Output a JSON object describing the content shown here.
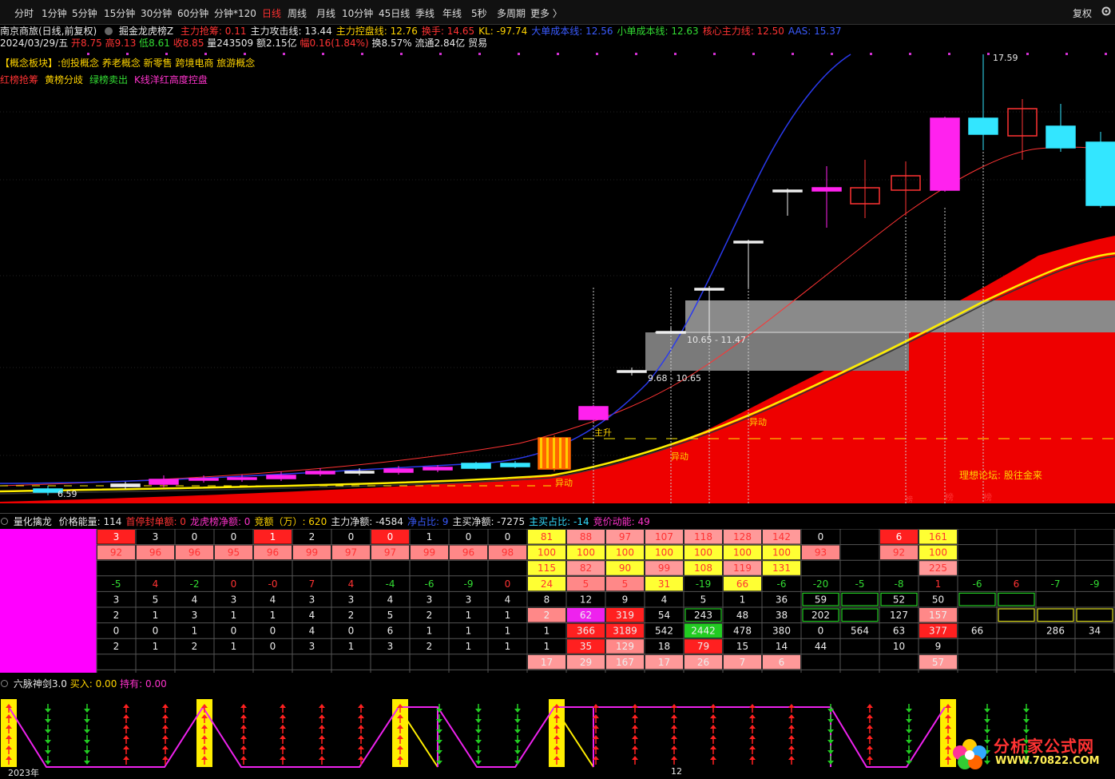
{
  "toolbar": {
    "items": [
      "分时",
      "1分钟",
      "5分钟",
      "15分钟",
      "30分钟",
      "60分钟",
      "分钟*120",
      "日线",
      "周线",
      "月线",
      "10分钟",
      "45日线",
      "季线",
      "年线",
      "5秒",
      "多周期",
      "更多 〉"
    ],
    "active_index": 7,
    "right": "复权"
  },
  "header": {
    "title": "南京商旅(日线,前复权)",
    "indicator": "掘金龙虎榜Z",
    "metrics": [
      {
        "k": "主力抢筹: ",
        "v": "0.11",
        "c": "red"
      },
      {
        "k": "主力攻击线: ",
        "v": "13.44",
        "c": "white"
      },
      {
        "k": "主力控盘线: ",
        "v": "12.76",
        "c": "yel"
      },
      {
        "k": "换手: ",
        "v": "14.65",
        "c": "red"
      },
      {
        "k": "KL: ",
        "v": "-97.74",
        "c": "yel"
      },
      {
        "k": "大单成本线: ",
        "v": "12.56",
        "c": "blue"
      },
      {
        "k": "小单成本线: ",
        "v": "12.63",
        "c": "grn"
      },
      {
        "k": "核心主力线: ",
        "v": "12.50",
        "c": "red"
      },
      {
        "k": "AAS: ",
        "v": "15.37",
        "c": "blue"
      }
    ],
    "date": "2024/03/29/五",
    "open": "开8.75",
    "high": "高9.13",
    "low": "低8.61",
    "close": "收8.85",
    "volume": "量243509",
    "amount": "额2.15亿",
    "change": "幅0.16(1.84%)",
    "turnover": "换8.57%",
    "float": "流通2.84亿",
    "sector_tag": "贸易",
    "concept": "【概念板块】:创投概念 养老概念 新零售 跨境电商 旅游概念",
    "legend": [
      {
        "t": "红榜抢筹",
        "c": "red"
      },
      {
        "t": "黄榜分歧",
        "c": "yel"
      },
      {
        "t": "绿榜卖出",
        "c": "grn"
      },
      {
        "t": "K线洋红高度控盘",
        "c": "mag"
      }
    ]
  },
  "annotations": {
    "high_label": "17.59",
    "low_label": "6.59",
    "zone_upper": "10.65 - 11.47",
    "zone_lower": "9.68 - 10.65",
    "zhusheng": "主升",
    "yidong": [
      "异动",
      "异动",
      "异动"
    ],
    "bang": [
      "榜",
      "榜",
      "榜"
    ],
    "forum": "理想论坛: 股往金来"
  },
  "panel2": {
    "title": "量化擒龙",
    "metrics": [
      {
        "k": "价格能量: ",
        "v": "114",
        "c": "white"
      },
      {
        "k": "首停封单额: ",
        "v": "0",
        "c": "red"
      },
      {
        "k": "龙虎榜净额: ",
        "v": "0",
        "c": "mag"
      },
      {
        "k": "竞额（万）: ",
        "v": "620",
        "c": "yel"
      },
      {
        "k": "主力净额: ",
        "v": "-4584",
        "c": "white"
      },
      {
        "k": "净占比: ",
        "v": "9",
        "c": "blue"
      },
      {
        "k": "主买净额: ",
        "v": "-7275",
        "c": "white"
      },
      {
        "k": "主买占比: ",
        "v": "-14",
        "c": "cyan"
      },
      {
        "k": "竞价动能: ",
        "v": "49",
        "c": "mag"
      }
    ],
    "rows": [
      [
        "3",
        "3",
        "0",
        "0",
        "1",
        "2",
        "0",
        "0",
        "1",
        "0",
        "0",
        "81",
        "88",
        "97",
        "107",
        "118",
        "128",
        "142",
        "0",
        "",
        "6",
        "161",
        "",
        "",
        "",
        "",
        ""
      ],
      [
        "92",
        "96",
        "96",
        "95",
        "96",
        "99",
        "97",
        "97",
        "99",
        "96",
        "98",
        "100",
        "100",
        "100",
        "100",
        "100",
        "100",
        "100",
        "93",
        "",
        "92",
        "100",
        "",
        "",
        "",
        "",
        ""
      ],
      [
        "",
        "",
        "",
        "",
        "",
        "",
        "",
        "",
        "",
        "",
        "",
        "115",
        "82",
        "90",
        "99",
        "108",
        "119",
        "131",
        "",
        "",
        "",
        "225",
        "",
        "",
        "",
        "",
        ""
      ],
      [
        "-5",
        "4",
        "-2",
        "0",
        "-0",
        "7",
        "4",
        "-4",
        "-6",
        "-9",
        "0",
        "24",
        "5",
        "5",
        "31",
        "-19",
        "66",
        "-6",
        "-20",
        "-5",
        "-8",
        "1",
        "-6",
        "6",
        "-7",
        "-9",
        ""
      ],
      [
        "3",
        "5",
        "4",
        "3",
        "4",
        "3",
        "3",
        "4",
        "3",
        "3",
        "4",
        "8",
        "12",
        "9",
        "4",
        "5",
        "1",
        "36",
        "59",
        "",
        "52",
        "50",
        "",
        "",
        "",
        "",
        ""
      ],
      [
        "2",
        "1",
        "3",
        "1",
        "1",
        "4",
        "2",
        "5",
        "2",
        "1",
        "1",
        "2",
        "62",
        "319",
        "54",
        "243",
        "48",
        "38",
        "202",
        "",
        "127",
        "157",
        "",
        "",
        "",
        "",
        ""
      ],
      [
        "0",
        "0",
        "1",
        "0",
        "0",
        "4",
        "0",
        "6",
        "1",
        "1",
        "1",
        "1",
        "366",
        "3189",
        "542",
        "2442",
        "478",
        "380",
        "0",
        "564",
        "63",
        "377",
        "66",
        "",
        "286",
        "34",
        ""
      ],
      [
        "2",
        "1",
        "2",
        "1",
        "0",
        "3",
        "1",
        "3",
        "2",
        "1",
        "1",
        "1",
        "35",
        "129",
        "18",
        "79",
        "15",
        "14",
        "44",
        "",
        "10",
        "9",
        "",
        "",
        "",
        "",
        ""
      ],
      [
        "",
        "",
        "",
        "",
        "",
        "",
        "",
        "",
        "",
        "",
        "",
        "17",
        "29",
        "167",
        "17",
        "26",
        "7",
        "6",
        "",
        "",
        "",
        "57",
        "",
        "",
        "",
        "",
        ""
      ]
    ]
  },
  "panel3": {
    "title": "六脉神剑3.0",
    "buy_label": "买入: ",
    "buy_value": "0.00",
    "hold_label": "持有: ",
    "hold_value": "0.00",
    "year_label": "2023年",
    "month_label": "12"
  },
  "watermark": {
    "line1": "分析家公式网",
    "line2": "WWW.70822.COM"
  },
  "colors": {
    "bull_red": "#ff2020",
    "bear_cyan": "#33e6ff",
    "magenta": "#ff22ee",
    "yellow": "#ffee00",
    "pink": "#ff9090"
  }
}
